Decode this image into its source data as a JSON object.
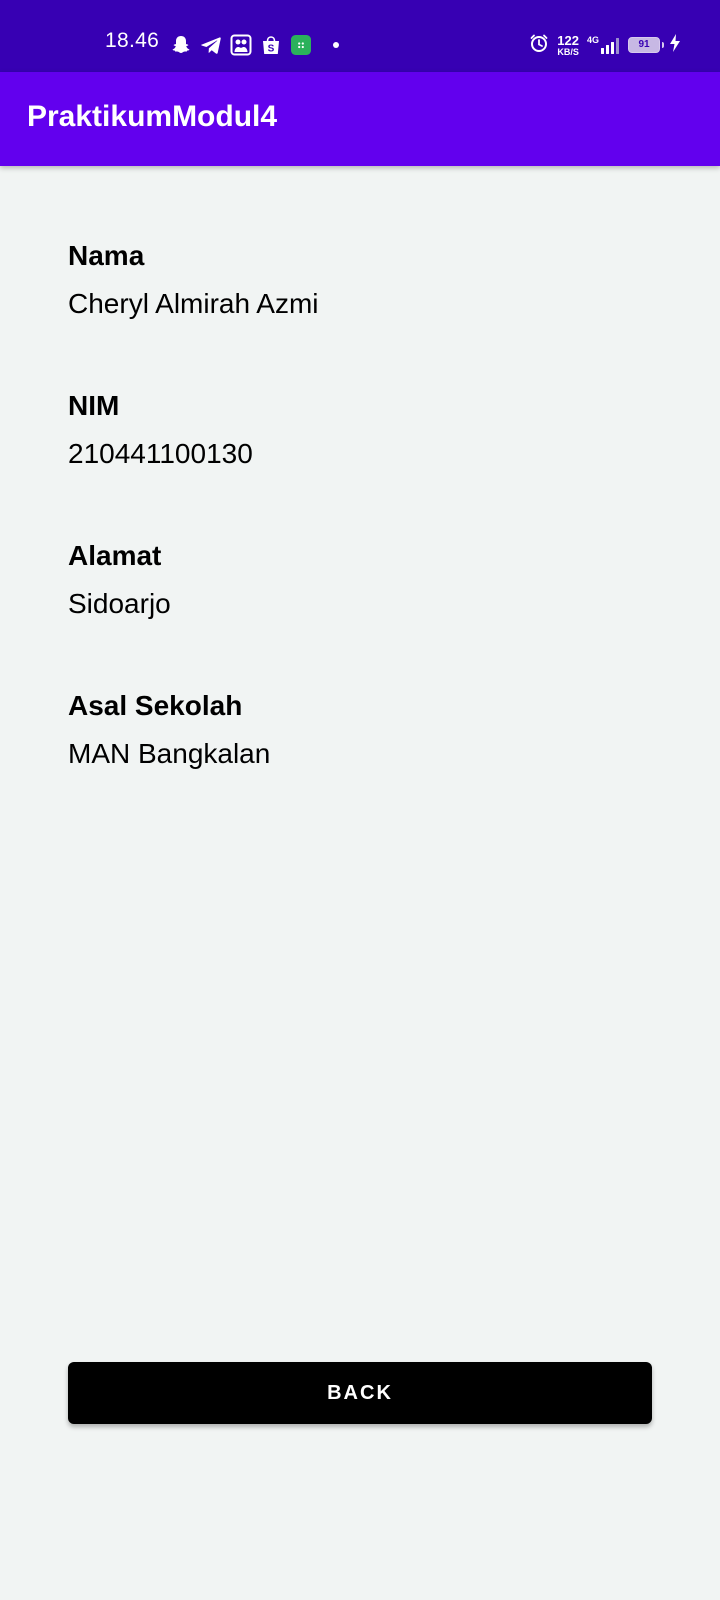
{
  "status_bar": {
    "time": "18.46",
    "speed_value": "122",
    "speed_unit": "KB/S",
    "network": "4G",
    "battery": "91",
    "left_icons": [
      "snapchat-icon",
      "telegram-icon",
      "gallery-icon",
      "shopee-icon",
      "green-app-icon",
      "dot-icon"
    ],
    "right_icons": [
      "alarm-icon",
      "signal-icon",
      "charging-icon"
    ]
  },
  "app_bar": {
    "title": "PraktikumModul4",
    "color": "#6200ee",
    "status_color": "#3700b3"
  },
  "fields": [
    {
      "label": "Nama",
      "value": "Cheryl Almirah Azmi"
    },
    {
      "label": "NIM",
      "value": "210441100130"
    },
    {
      "label": "Alamat",
      "value": "Sidoarjo"
    },
    {
      "label": "Asal Sekolah",
      "value": "MAN Bangkalan"
    }
  ],
  "back_button": {
    "label": "BACK",
    "color": "#000000"
  },
  "background": "#f1f4f3"
}
